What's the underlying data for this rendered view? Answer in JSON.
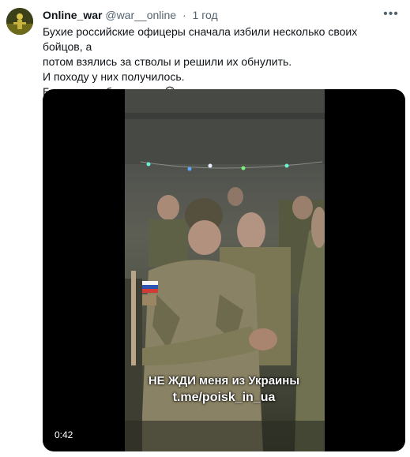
{
  "tweet": {
    "author_name": "Online_war",
    "author_handle": "@war__online",
    "separator": "·",
    "timestamp": "1 год",
    "more_icon": "more-horizontal-icon",
    "text_lines": [
      "Бухие российские офицеры сначала избили несколько своих бойцов, а",
      "потом взялись за стволы и решили их обнулить.",
      "И походу у них получилось.",
      "Болеем за обе стороны😆"
    ]
  },
  "media": {
    "caption_line1": "НЕ ЖДИ меня из Украины",
    "caption_line2": "t.me/poisk_in_ua",
    "duration": "0:42"
  }
}
